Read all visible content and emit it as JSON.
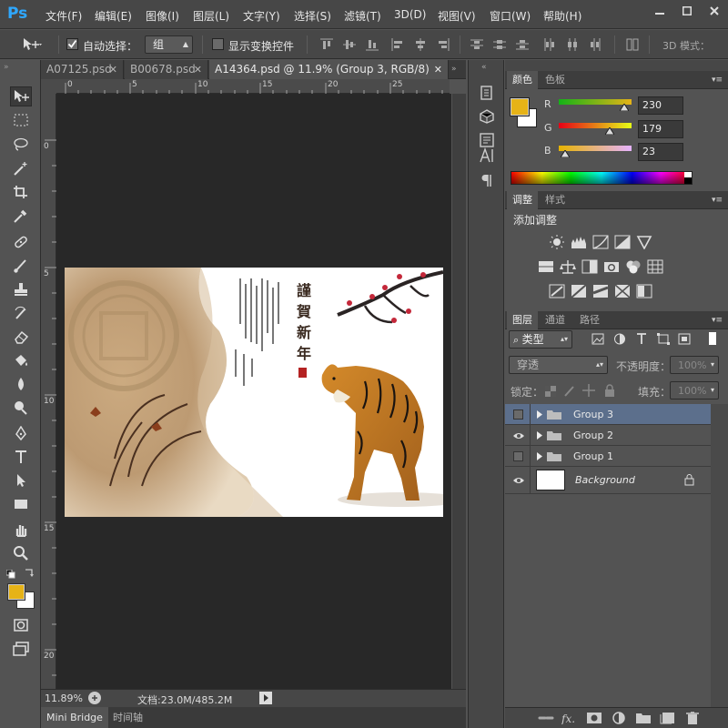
{
  "app": {
    "logo": "Ps"
  },
  "menu": [
    "文件(F)",
    "编辑(E)",
    "图像(I)",
    "图层(L)",
    "文字(Y)",
    "选择(S)",
    "滤镜(T)",
    "3D(D)",
    "视图(V)",
    "窗口(W)",
    "帮助(H)"
  ],
  "options": {
    "auto_select_label": "自动选择：",
    "auto_select_value": "组",
    "show_transform_label": "显示变换控件",
    "mode_3d_label": "3D 模式："
  },
  "tabs": [
    {
      "label": "A07125.psd"
    },
    {
      "label": "B00678.psd"
    },
    {
      "label": "A14364.psd @ 11.9% (Group 3, RGB/8)"
    }
  ],
  "ruler": {
    "h": [
      "0",
      "5",
      "10",
      "15",
      "20",
      "25"
    ],
    "v": [
      "0",
      "5",
      "10",
      "15",
      "20"
    ]
  },
  "artwork": {
    "title_chars": [
      "謹",
      "賀",
      "新",
      "年"
    ]
  },
  "status": {
    "zoom": "11.89%",
    "doc": "文档:23.0M/485.2M"
  },
  "bottom_tabs": [
    "Mini Bridge",
    "时间轴"
  ],
  "color_panel": {
    "tabs": [
      "颜色",
      "色板"
    ],
    "r_label": "R",
    "g_label": "G",
    "b_label": "B",
    "r": "230",
    "g": "179",
    "b": "23",
    "r_pct": 0.9,
    "g_pct": 0.7,
    "b_pct": 0.09,
    "fg": "#e6b317"
  },
  "adjust_panel": {
    "tabs": [
      "调整",
      "样式"
    ],
    "heading": "添加调整"
  },
  "layers_panel": {
    "tabs": [
      "图层",
      "通道",
      "路径"
    ],
    "filter": "类型",
    "blend": "穿透",
    "opacity_label": "不透明度：",
    "opacity": "100%",
    "lock_label": "锁定：",
    "fill_label": "填充：",
    "fill": "100%",
    "layers": [
      {
        "name": "Group 3",
        "visible": false,
        "selected": true
      },
      {
        "name": "Group 2",
        "visible": true,
        "selected": false
      },
      {
        "name": "Group 1",
        "visible": false,
        "selected": false
      },
      {
        "name": "Background",
        "visible": true,
        "selected": false
      }
    ]
  }
}
